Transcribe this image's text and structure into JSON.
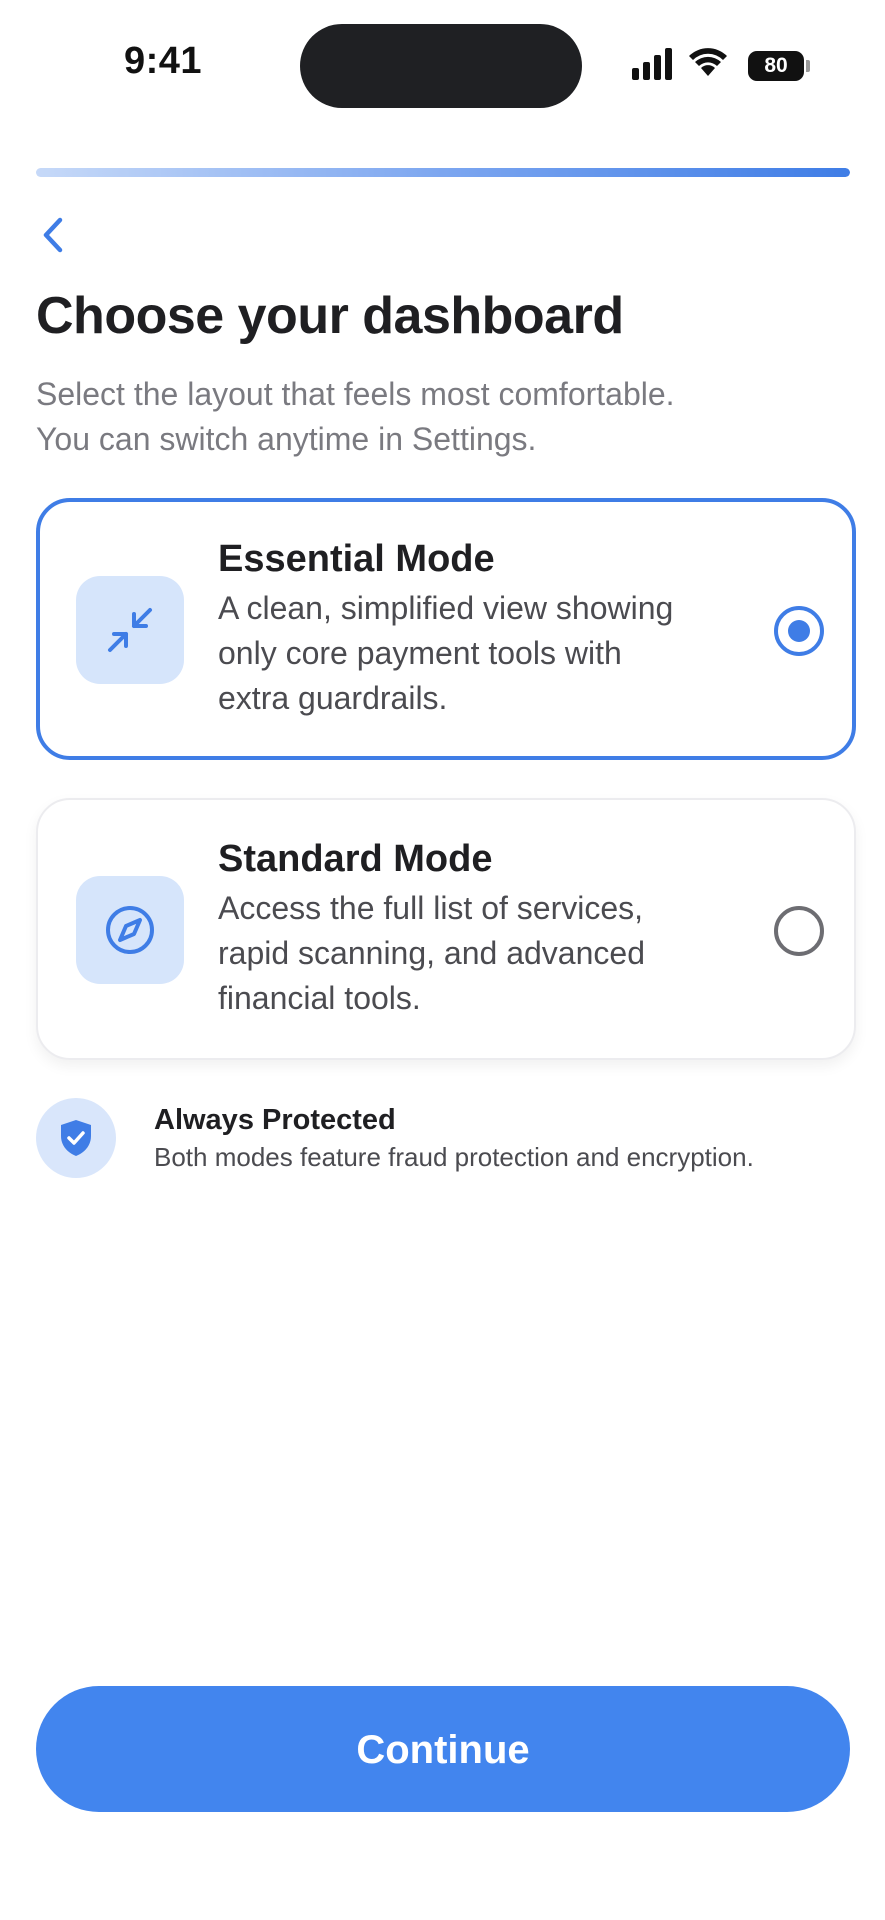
{
  "status_bar": {
    "time": "9:41",
    "battery": "80"
  },
  "onboarding": {
    "progress": 1.0
  },
  "header": {
    "title": "Choose your dashboard",
    "subtitle_line1": "Select the layout that feels most comfortable.",
    "subtitle_line2": "You can switch anytime in Settings."
  },
  "options": [
    {
      "title": "Essential Mode",
      "desc_line1": "A clean, simplified view showing",
      "desc_line2": "only core payment tools with",
      "desc_line3": "extra guardrails.",
      "icon": "arrows-collapse-icon",
      "selected": true
    },
    {
      "title": "Standard Mode",
      "desc_line1": "Access the full list of services,",
      "desc_line2": "rapid scanning, and advanced",
      "desc_line3": "financial tools.",
      "icon": "compass-icon",
      "selected": false
    }
  ],
  "protection": {
    "title": "Always Protected",
    "description": "Both modes feature fraud protection and encryption.",
    "icon": "shield-check-icon"
  },
  "footer": {
    "continue_label": "Continue"
  },
  "colors": {
    "accent": "#3f7de6",
    "button": "#4285ee",
    "icon_bg": "#d6e5fb"
  }
}
